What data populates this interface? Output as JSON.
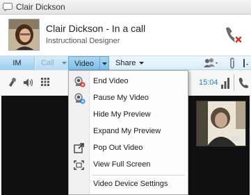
{
  "window": {
    "title": "Clair Dickson"
  },
  "contact": {
    "name": "Clair Dickson - In a call",
    "role": "Instructional Designer"
  },
  "toolbar": {
    "im_label": "IM",
    "call_label": "Call",
    "video_label": "Video",
    "share_label": "Share"
  },
  "call_status": {
    "timer": "15:04"
  },
  "video_menu": {
    "items": [
      {
        "label": "End Video",
        "icon": "end-video-icon"
      },
      {
        "label": "Pause My Video",
        "icon": "pause-video-icon"
      },
      {
        "label": "Hide My Preview",
        "icon": ""
      },
      {
        "label": "Expand My Preview",
        "icon": ""
      },
      {
        "label": "Pop Out Video",
        "icon": "pop-out-icon"
      },
      {
        "label": "View Full Screen",
        "icon": "full-screen-icon"
      },
      {
        "label": "Video Device Settings",
        "icon": ""
      }
    ]
  },
  "colors": {
    "accent_blue": "#1a7fbf",
    "toolbar_blue": "#dbedf9",
    "hangup_red": "#d9301e",
    "video_bg": "#101010"
  }
}
